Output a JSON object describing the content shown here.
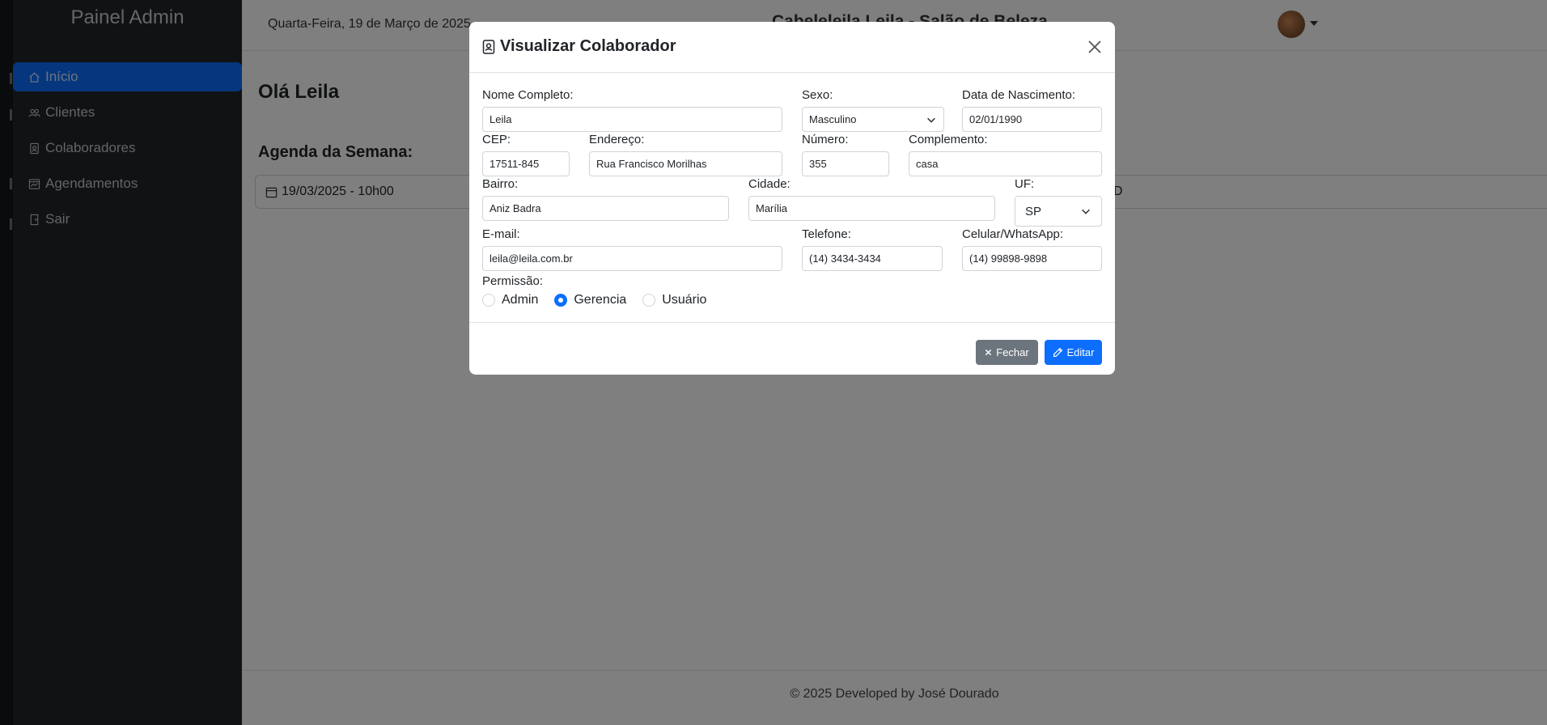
{
  "sidebar": {
    "title": "Painel Admin",
    "items": [
      {
        "label": "Início",
        "icon": "house-icon"
      },
      {
        "label": "Clientes",
        "icon": "people-icon"
      },
      {
        "label": "Colaboradores",
        "icon": "person-badge-icon"
      },
      {
        "label": "Agendamentos",
        "icon": "calendar-chart-icon"
      },
      {
        "label": "Sair",
        "icon": "door-icon"
      }
    ]
  },
  "topbar": {
    "date": "Quarta-Feira, 19 de Março de 2025",
    "brand": "Cabeleleila Leila - Salão de Beleza"
  },
  "main": {
    "greeting": "Olá Leila",
    "agenda_title": "Agenda da Semana:",
    "agenda_item_date": "19/03/2025 - 10h00",
    "agenda_item_right": "D"
  },
  "footer": {
    "text": "© 2025 Developed by José Dourado"
  },
  "modal": {
    "title": "Visualizar Colaborador",
    "labels": {
      "nome": "Nome Completo:",
      "sexo": "Sexo:",
      "nascimento": "Data de Nascimento:",
      "cep": "CEP:",
      "endereco": "Endereço:",
      "numero": "Número:",
      "complemento": "Complemento:",
      "bairro": "Bairro:",
      "cidade": "Cidade:",
      "uf": "UF:",
      "email": "E-mail:",
      "telefone": "Telefone:",
      "celular": "Celular/WhatsApp:",
      "permissao": "Permissão:"
    },
    "values": {
      "nome": "Leila",
      "sexo": "Masculino",
      "nascimento": "02/01/1990",
      "cep": "17511-845",
      "endereco": "Rua Francisco Morilhas",
      "numero": "355",
      "complemento": "casa",
      "bairro": "Aniz Badra",
      "cidade": "Marília",
      "uf": "SP",
      "email": "leila@leila.com.br",
      "telefone": "(14) 3434-3434",
      "celular": "(14) 99898-9898"
    },
    "permissions": [
      {
        "label": "Admin",
        "checked": false
      },
      {
        "label": "Gerencia",
        "checked": true
      },
      {
        "label": "Usuário",
        "checked": false
      }
    ],
    "buttons": {
      "close": "Fechar",
      "edit": "Editar"
    }
  },
  "colors": {
    "primary": "#0d6efd",
    "secondary": "#6c757d",
    "sidebar": "#212529"
  }
}
